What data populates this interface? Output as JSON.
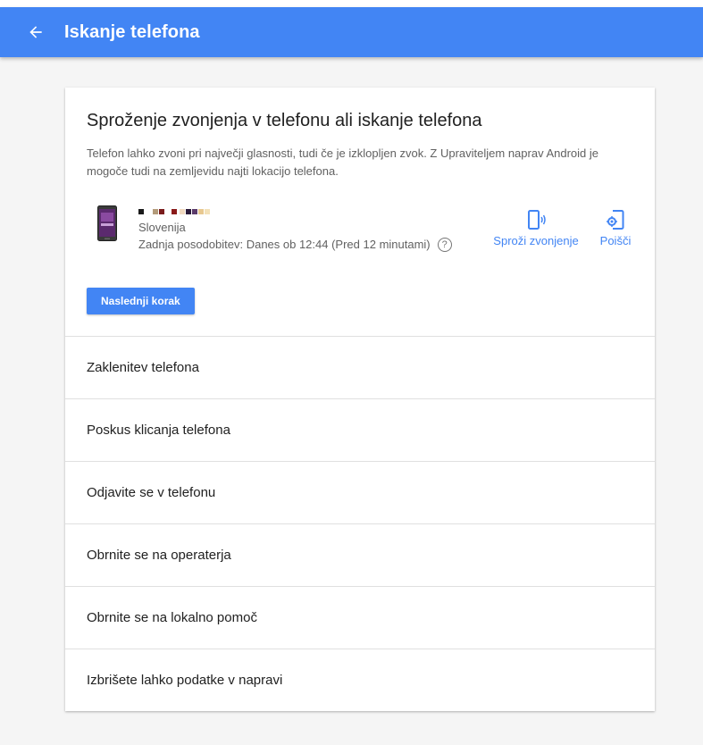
{
  "appbar": {
    "title": "Iskanje telefona",
    "back_icon": "arrow-back-icon"
  },
  "card": {
    "title": "Sproženje zvonjenja v telefonu ali iskanje telefona",
    "description": "Telefon lahko zvoni pri največji glasnosti, tudi če je izklopljen zvok. Z Upraviteljem naprav Android je mogoče tudi na zemljevidu najti lokacijo telefona."
  },
  "device": {
    "name_pixels": [
      "#1a1a1a",
      "#ffffff",
      "#b39b7a",
      "#7a1c1c",
      "#ffffff",
      "#8a1a1a",
      "#f0d9c0",
      "#2a1a3a",
      "#5a3a6a",
      "#e8c890",
      "#f3e1b9"
    ],
    "country": "Slovenija",
    "last_update": "Zadnja posodobitev: Danes ob 12:44 (Pred 12 minutami)",
    "help_icon": "?"
  },
  "actions": {
    "ring_label": "Sproži zvonjenje",
    "find_label": "Poišči"
  },
  "next_button": "Naslednji korak",
  "list": [
    "Zaklenitev telefona",
    "Poskus klicanja telefona",
    "Odjavite se v telefonu",
    "Obrnite se na operaterja",
    "Obrnite se na lokalno pomoč",
    "Izbrišete lahko podatke v napravi"
  ],
  "colors": {
    "accent": "#4285f4",
    "background": "#f5f5f5"
  }
}
